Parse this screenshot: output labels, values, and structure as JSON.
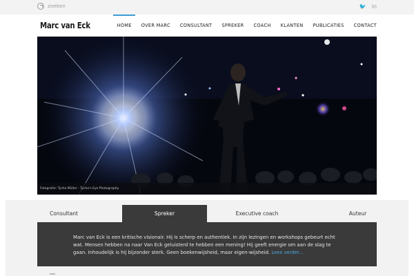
{
  "topbar": {
    "search_placeholder": "zoeken",
    "social": [
      {
        "icon": "twitter-icon",
        "glyph": "🐦"
      },
      {
        "icon": "linkedin-icon",
        "glyph": "in"
      }
    ]
  },
  "header": {
    "logo": "Marc van Eck",
    "nav": [
      {
        "label": "HOME",
        "active": true
      },
      {
        "label": "OVER MARC"
      },
      {
        "label": "CONSULTANT"
      },
      {
        "label": "SPREKER"
      },
      {
        "label": "COACH"
      },
      {
        "label": "KLANTEN"
      },
      {
        "label": "PUBLICATIES"
      },
      {
        "label": "CONTACT"
      }
    ],
    "accent_color": "#3b9bd4"
  },
  "hero": {
    "credit": "Fotografie: Tycho Müller - Tycho's Eye Photography"
  },
  "tabs": [
    {
      "label": "Consultant"
    },
    {
      "label": "Spreker",
      "active": true
    },
    {
      "label": "Executive coach"
    },
    {
      "label": "Auteur"
    }
  ],
  "panel": {
    "text": "Marc van Eck is een kritische visionair. Hij is scherp en authentiek. In zijn lezingen en workshops gebeurt echt wat. Mensen hebben na naar Van Eck geluisterd te hebben een mening! Hij geeft energie om aan de slag te gaan. Inhoudelijk is hij bijzonder sterk. Geen boekenwijsheid, maar eigen-wijsheid.",
    "read_more": "Lees verder..."
  }
}
